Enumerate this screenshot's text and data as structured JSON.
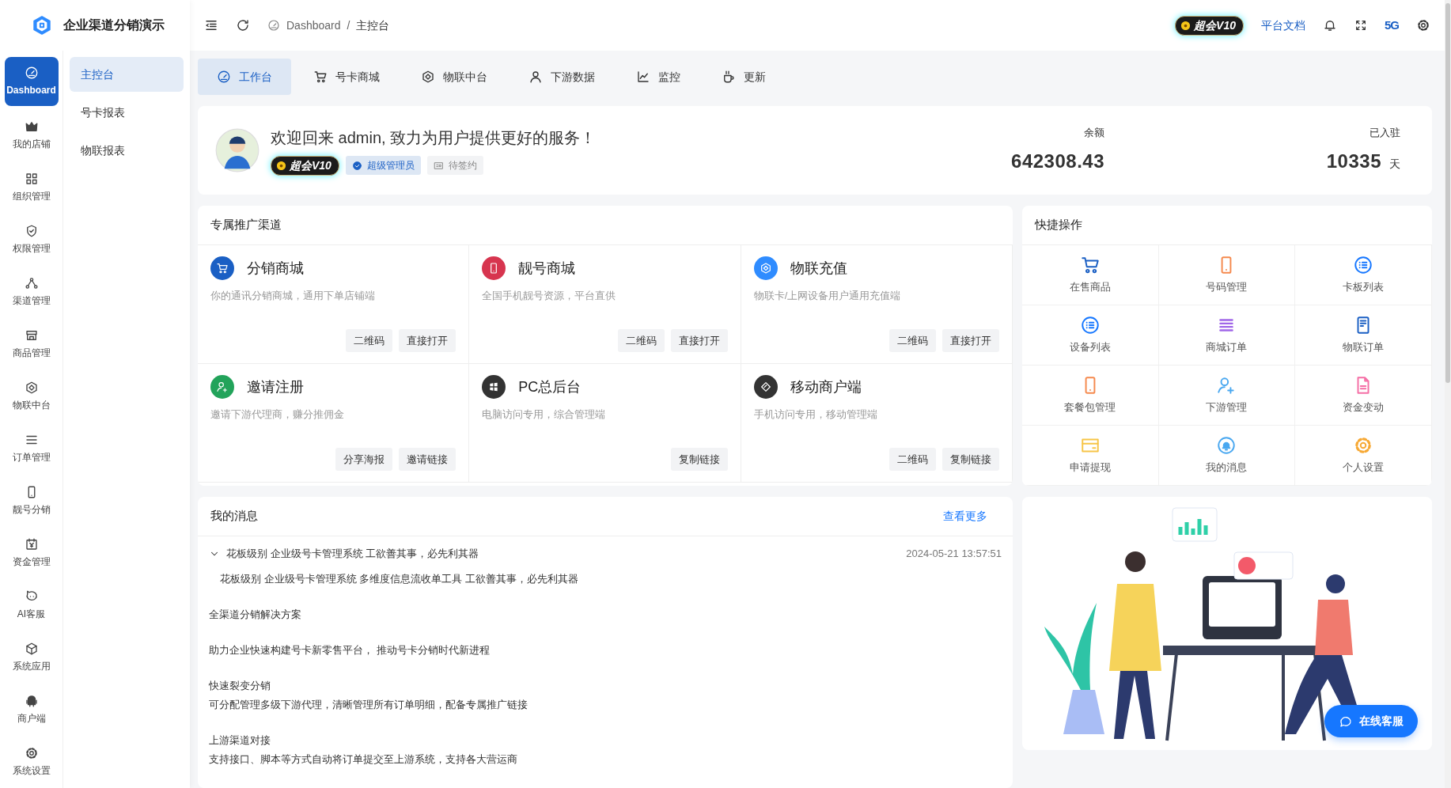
{
  "app": {
    "title": "企业渠道分销演示"
  },
  "rail": [
    {
      "label": "Dashboard",
      "selected": true
    },
    {
      "label": "我的店铺",
      "selected": false
    },
    {
      "label": "组织管理",
      "selected": false
    },
    {
      "label": "权限管理",
      "selected": false
    },
    {
      "label": "渠道管理",
      "selected": false
    },
    {
      "label": "商品管理",
      "selected": false
    },
    {
      "label": "物联中台",
      "selected": false
    },
    {
      "label": "订单管理",
      "selected": false
    },
    {
      "label": "靓号分销",
      "selected": false
    },
    {
      "label": "资金管理",
      "selected": false
    },
    {
      "label": "AI客服",
      "selected": false
    },
    {
      "label": "系统应用",
      "selected": false
    },
    {
      "label": "商户端",
      "selected": false
    },
    {
      "label": "系统设置",
      "selected": false
    }
  ],
  "submenu": [
    {
      "label": "主控台",
      "selected": true
    },
    {
      "label": "号卡报表",
      "selected": false
    },
    {
      "label": "物联报表",
      "selected": false
    }
  ],
  "breadcrumb": {
    "items": [
      "Dashboard",
      "主控台"
    ],
    "separator": "/"
  },
  "header": {
    "vip_badge": "超会V10",
    "docs_link": "平台文档",
    "network_logo": "5G"
  },
  "tabs": [
    {
      "label": "工作台",
      "selected": true
    },
    {
      "label": "号卡商城",
      "selected": false
    },
    {
      "label": "物联中台",
      "selected": false
    },
    {
      "label": "下游数据",
      "selected": false
    },
    {
      "label": "监控",
      "selected": false
    },
    {
      "label": "更新",
      "selected": false
    }
  ],
  "welcome": {
    "greeting": "欢迎回来 admin, 致力为用户提供更好的服务！",
    "vip_badge": "超会V10",
    "role": "超级管理员",
    "contract": "待签约",
    "stats": [
      {
        "label": "余额",
        "value": "642308.43"
      },
      {
        "label": "已入驻",
        "value": "10335",
        "unit": "天"
      }
    ]
  },
  "channels": {
    "title": "专属推广渠道",
    "items": [
      {
        "name": "分销商城",
        "description": "你的通讯分销商城，通用下单店铺端",
        "buttons": [
          "二维码",
          "直接打开"
        ]
      },
      {
        "name": "靓号商城",
        "description": "全国手机靓号资源，平台直供",
        "buttons": [
          "二维码",
          "直接打开"
        ]
      },
      {
        "name": "物联充值",
        "description": "物联卡/上网设备用户通用充值端",
        "buttons": [
          "二维码",
          "直接打开"
        ]
      },
      {
        "name": "邀请注册",
        "description": "邀请下游代理商，赚分推佣金",
        "buttons": [
          "分享海报",
          "邀请链接"
        ]
      },
      {
        "name": "PC总后台",
        "description": "电脑访问专用，综合管理端",
        "buttons": [
          "复制链接"
        ]
      },
      {
        "name": "移动商户端",
        "description": "手机访问专用，移动管理端",
        "buttons": [
          "二维码",
          "复制链接"
        ]
      }
    ]
  },
  "quick_actions": {
    "title": "快捷操作",
    "items": [
      "在售商品",
      "号码管理",
      "卡板列表",
      "设备列表",
      "商城订单",
      "物联订单",
      "套餐包管理",
      "下游管理",
      "资金变动",
      "申请提现",
      "我的消息",
      "个人设置"
    ]
  },
  "messages": {
    "title": "我的消息",
    "more": "查看更多",
    "items": [
      {
        "title": "花板级别 企业级号卡管理系统 工欲善其事，必先利其器",
        "time": "2024-05-21 13:57:51",
        "expanded": true,
        "body": [
          [
            "花板级别 企业级号卡管理系统 多维度信息流收单工具 工欲善其事，必先利其器"
          ],
          [
            "全渠道分销解决方案"
          ],
          [
            "助力企业快速构建号卡新零售平台， 推动号卡分销时代新进程"
          ],
          [
            "快速裂变分销",
            "可分配管理多级下游代理，清晰管理所有订单明细，配备专属推广链接"
          ],
          [
            "上游渠道对接",
            "支持接口、脚本等方式自动将订单提交至上游系统，支持各大营运商"
          ]
        ]
      }
    ]
  },
  "chat_button": "在线客服"
}
